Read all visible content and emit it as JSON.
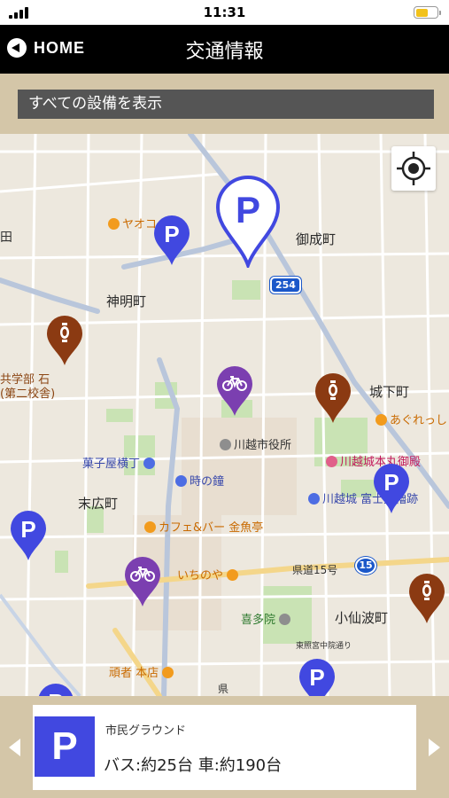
{
  "status": {
    "time": "11:31",
    "battery_percent": 60
  },
  "nav": {
    "home_label": "HOME",
    "title": "交通情報"
  },
  "filter": {
    "label": "すべての設備を表示"
  },
  "map": {
    "labels": {
      "onari": "御成町",
      "shinmei": "神明町",
      "joka": "城下町",
      "suehiro": "末広町",
      "kosenba": "小仙波町",
      "city_hall": "川越市役所",
      "kashiya": "菓子屋横丁",
      "toki": "時の鐘",
      "cafe": "カフェ&バー 金魚亭",
      "ichinoya": "いちのや",
      "kitain": "喜多院",
      "honmaru": "川越城本丸御殿",
      "fujimi": "川越城 富士見櫓跡",
      "agure": "あぐれっし",
      "yaoko": "ヤオコ",
      "kyosai1": "共学部 石",
      "kyosai2": "(第二校舎)",
      "route15": "県道15号",
      "toshogu": "東照宮中院通り",
      "ganja": "頑者 本店",
      "ken": "県",
      "left_edge": "田"
    },
    "badges": {
      "r254": "254",
      "r15": "15"
    }
  },
  "card": {
    "icon_letter": "P",
    "name": "市民グラウンド",
    "detail": "バス:約25台 車:約190台"
  },
  "colors": {
    "parking": "#4148e0",
    "bicycle": "#7b3fb0",
    "sightseeing": "#8b3a12",
    "panel": "#d4c6a8"
  }
}
